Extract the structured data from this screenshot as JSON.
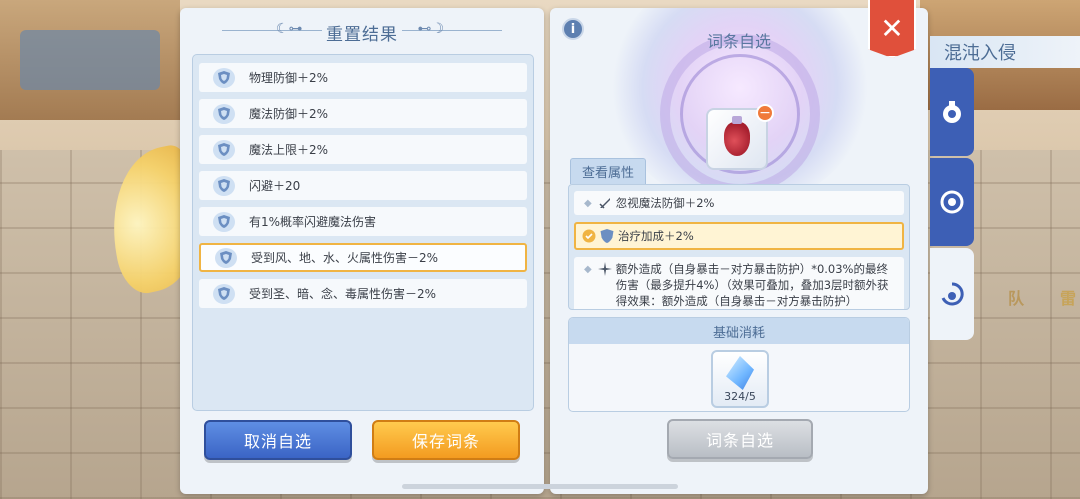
{
  "left_panel": {
    "title": "重置结果",
    "attributes": [
      {
        "text": "物理防御＋2%",
        "selected": false
      },
      {
        "text": "魔法防御＋2%",
        "selected": false
      },
      {
        "text": "魔法上限＋2%",
        "selected": false
      },
      {
        "text": "闪避＋20",
        "selected": false
      },
      {
        "text": "有1%概率闪避魔法伤害",
        "selected": false
      },
      {
        "text": "受到风、地、水、火属性伤害－2%",
        "selected": true
      },
      {
        "text": "受到圣、暗、念、毒属性伤害－2%",
        "selected": false
      }
    ],
    "cancel_label": "取消自选",
    "save_label": "保存词条"
  },
  "right_panel": {
    "title": "词条自选",
    "info_label": "i",
    "view_attr_label": "查看属性",
    "attr_list": [
      {
        "text": "忽视魔法防御＋2%"
      },
      {
        "text": "治疗加成＋2%"
      },
      {
        "text": "额外造成（自身暴击－对方暴击防护）*0.03%的最终伤害（最多提升4%）（效果可叠加，叠加3层时额外获得效果：额外造成（自身暴击－对方暴击防护）*0.06%的最终伤害"
      }
    ],
    "cost_title": "基础消耗",
    "cost_count": "324/5",
    "confirm_label": "词条自选",
    "minus_label": "−"
  },
  "close_label": "✕",
  "side": {
    "banner": "混沌入侵",
    "hint1": "队",
    "hint2": "雷"
  },
  "colors": {
    "accent_blue": "#3d5fb5",
    "save_orange": "#f39b20",
    "cancel_blue": "#3b64c5",
    "close_red": "#e0503b",
    "selected_border": "#f0b443"
  }
}
